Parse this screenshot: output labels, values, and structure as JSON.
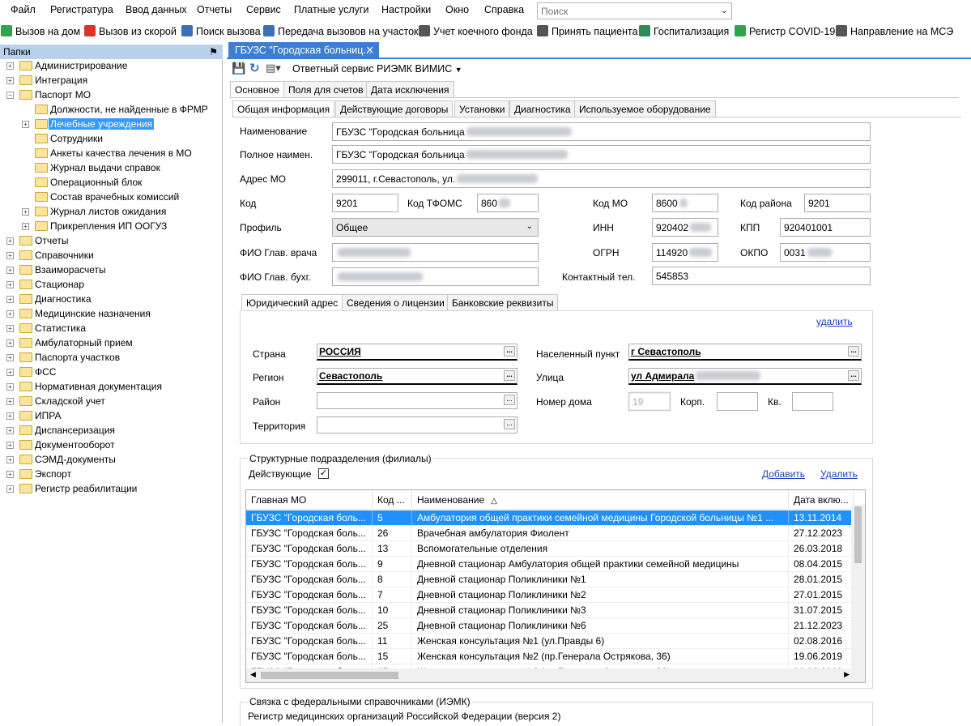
{
  "menu": [
    "Файл",
    "Регистратура",
    "Ввод данных",
    "Отчеты",
    "Сервис",
    "Платные услуги",
    "Настройки",
    "Окно",
    "Справка"
  ],
  "search": {
    "placeholder": "Поиск"
  },
  "toolbar": [
    {
      "label": "Вызов на дом",
      "icon": "check-icon",
      "color": "#2ea44f"
    },
    {
      "label": "Вызов из скорой",
      "icon": "ambulance-icon",
      "color": "#d9352b"
    },
    {
      "label": "Поиск вызова",
      "icon": "search-icon",
      "color": "#3c6fb4"
    },
    {
      "label": "Передача вызовов на участок",
      "icon": "transfer-icon",
      "color": "#3c6fb4"
    },
    {
      "label": "Учет коечного фонда",
      "icon": "bed-icon",
      "color": "#555555"
    },
    {
      "label": "Принять пациента",
      "icon": "patient-icon",
      "color": "#555555"
    },
    {
      "label": "Госпитализация",
      "icon": "hospital-icon",
      "color": "#2e8b57"
    },
    {
      "label": "Регистр COVID-19",
      "icon": "virus-icon",
      "color": "#2ea44f"
    },
    {
      "label": "Направление на МСЭ",
      "icon": "referral-icon",
      "color": "#555555"
    }
  ],
  "left_panel": {
    "title": "Папки",
    "tree": [
      {
        "label": "Администрирование",
        "level": 0,
        "exp": "+"
      },
      {
        "label": "Интеграция",
        "level": 0,
        "exp": "+"
      },
      {
        "label": "Паспорт МО",
        "level": 0,
        "exp": "-"
      },
      {
        "label": "Должности, не найденные в ФРМР",
        "level": 1,
        "exp": ""
      },
      {
        "label": "Лечебные учреждения",
        "level": 1,
        "exp": "+",
        "selected": true
      },
      {
        "label": "Сотрудники",
        "level": 1,
        "exp": ""
      },
      {
        "label": "Анкеты качества лечения в МО",
        "level": 1,
        "exp": ""
      },
      {
        "label": "Журнал выдачи справок",
        "level": 1,
        "exp": ""
      },
      {
        "label": "Операционный блок",
        "level": 1,
        "exp": ""
      },
      {
        "label": "Состав врачебных комиссий",
        "level": 1,
        "exp": ""
      },
      {
        "label": "Журнал листов ожидания",
        "level": 1,
        "exp": "+"
      },
      {
        "label": "Прикрепления ИП ООГУЗ",
        "level": 1,
        "exp": "+"
      },
      {
        "label": "Отчеты",
        "level": 0,
        "exp": "+"
      },
      {
        "label": "Справочники",
        "level": 0,
        "exp": "+"
      },
      {
        "label": "Взаиморасчеты",
        "level": 0,
        "exp": "+"
      },
      {
        "label": "Стационар",
        "level": 0,
        "exp": "+"
      },
      {
        "label": "Диагностика",
        "level": 0,
        "exp": "+"
      },
      {
        "label": "Медицинские назначения",
        "level": 0,
        "exp": "+"
      },
      {
        "label": "Статистика",
        "level": 0,
        "exp": "+"
      },
      {
        "label": "Амбулаторный прием",
        "level": 0,
        "exp": "+"
      },
      {
        "label": "Паспорта участков",
        "level": 0,
        "exp": "+"
      },
      {
        "label": "ФСС",
        "level": 0,
        "exp": "+"
      },
      {
        "label": "Нормативная документация",
        "level": 0,
        "exp": "+"
      },
      {
        "label": "Складской учет",
        "level": 0,
        "exp": "+"
      },
      {
        "label": "ИПРА",
        "level": 0,
        "exp": "+"
      },
      {
        "label": "Диспансеризация",
        "level": 0,
        "exp": "+"
      },
      {
        "label": "Документооборот",
        "level": 0,
        "exp": "+"
      },
      {
        "label": "СЭМД-документы",
        "level": 0,
        "exp": "+"
      },
      {
        "label": "Экспорт",
        "level": 0,
        "exp": "+"
      },
      {
        "label": "Регистр реабилитации",
        "level": 0,
        "exp": "+"
      }
    ]
  },
  "doc_tab": {
    "label": "ГБУЗС \"Городская больниц...",
    "close": "✕"
  },
  "sub_toolbar": {
    "service": "Ответный сервис РИЭМК ВИМИС"
  },
  "tabs_top": [
    "Основное",
    "Поля для счетов",
    "Дата исключения"
  ],
  "tabs_second": [
    "Общая информация",
    "Действующие договоры",
    "Установки",
    "Диагностика",
    "Используемое оборудование"
  ],
  "form": {
    "name_label": "Наименование",
    "name_value": "ГБУЗС \"Городская больница",
    "fullname_label": "Полное наимен.",
    "fullname_value": "ГБУЗС \"Городская больница",
    "address_label": "Адрес МО",
    "address_value": "299011, г.Севастополь, ул.",
    "code_label": "Код",
    "code_value": "9201",
    "tfoms_label": "Код ТФОМС",
    "tfoms_value": "860",
    "mo_code_label": "Код МО",
    "mo_code_value": "8600",
    "region_code_label": "Код района",
    "region_code_value": "9201",
    "profile_label": "Профиль",
    "profile_value": "Общее",
    "inn_label": "ИНН",
    "inn_value": "920402",
    "kpp_label": "КПП",
    "kpp_value": "920401001",
    "chief_label": "ФИО Глав. врача",
    "ogrn_label": "ОГРН",
    "ogrn_value": "114920",
    "okpo_label": "ОКПО",
    "okpo_value": "0031",
    "accountant_label": "ФИО Глав. бухг.",
    "phone_label": "Контактный тел.",
    "phone_value": "545853"
  },
  "address_tabs": [
    "Юридический адрес",
    "Сведения о лицензии",
    "Банковские реквизиты"
  ],
  "address": {
    "delete_link": "удалить",
    "country_label": "Страна",
    "country_value": "РОССИЯ",
    "region_label": "Регион",
    "region_value": "Севастополь",
    "district_label": "Район",
    "territory_label": "Территория",
    "locality_label": "Населенный пункт",
    "locality_value": "г Севастополь",
    "street_label": "Улица",
    "street_value": "ул Адмирала",
    "house_label": "Номер дома",
    "house_value": "19",
    "building_label": "Корп.",
    "apt_label": "Кв."
  },
  "branches": {
    "title": "Структурные подразделения (филиалы)",
    "active_label": "Действующие",
    "add_link": "Добавить",
    "delete_link": "Удалить",
    "columns": [
      "Главная МО",
      "Код ...",
      "Наименование",
      "Дата вклю..."
    ],
    "rows": [
      {
        "mo": "ГБУЗС \"Городская боль...",
        "code": "5",
        "name": "Амбулатория общей практики семейной медицины Городской больницы №1 ...",
        "date": "13.11.2014",
        "selected": true
      },
      {
        "mo": "ГБУЗС \"Городская боль...",
        "code": "26",
        "name": "Врачебная амбулатория Фиолент",
        "date": "27.12.2023"
      },
      {
        "mo": "ГБУЗС \"Городская боль...",
        "code": "13",
        "name": "Вспомогательные отделения",
        "date": "26.03.2018"
      },
      {
        "mo": "ГБУЗС \"Городская боль...",
        "code": "9",
        "name": "Дневной стационар Амбулатория общей практики семейной медицины",
        "date": "08.04.2015"
      },
      {
        "mo": "ГБУЗС \"Городская боль...",
        "code": "8",
        "name": "Дневной стационар Поликлиники №1",
        "date": "28.01.2015"
      },
      {
        "mo": "ГБУЗС \"Городская боль...",
        "code": "7",
        "name": "Дневной стационар Поликлиники №2",
        "date": "27.01.2015"
      },
      {
        "mo": "ГБУЗС \"Городская боль...",
        "code": "10",
        "name": "Дневной стационар Поликлиники №3",
        "date": "31.07.2015"
      },
      {
        "mo": "ГБУЗС \"Городская боль...",
        "code": "25",
        "name": "Дневной стационар Поликлиники №6",
        "date": "21.12.2023"
      },
      {
        "mo": "ГБУЗС \"Городская боль...",
        "code": "11",
        "name": "Женская консультация №1 (ул.Правды 6)",
        "date": "02.08.2016"
      },
      {
        "mo": "ГБУЗС \"Городская боль...",
        "code": "15",
        "name": "Женская консультация №2 (пр.Генерала Острякова, 36)",
        "date": "19.06.2019"
      }
    ]
  },
  "federal": {
    "title": "Связка с федеральными справочниками (ИЭМК)",
    "registry": "Регистр медицинских организаций Российской Федерации (версия 2)"
  }
}
